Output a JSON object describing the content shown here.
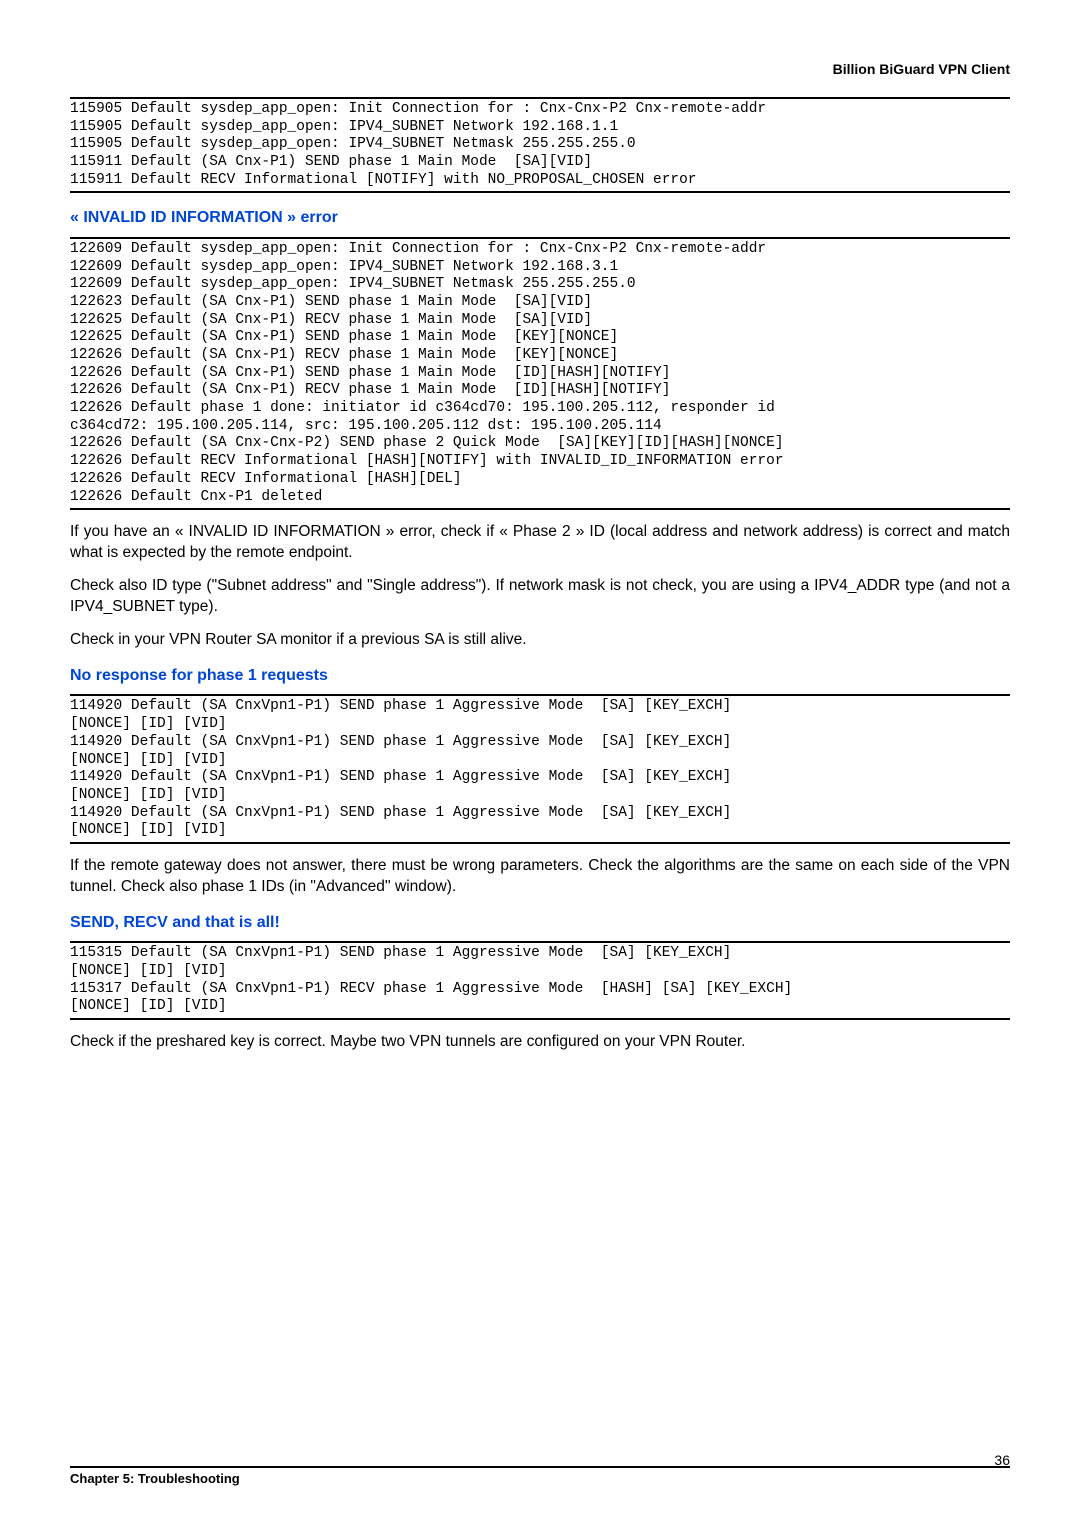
{
  "header": {
    "title": "Billion BiGuard VPN Client"
  },
  "logs": {
    "log1": "115905 Default sysdep_app_open: Init Connection for : Cnx-Cnx-P2 Cnx-remote-addr\n115905 Default sysdep_app_open: IPV4_SUBNET Network 192.168.1.1\n115905 Default sysdep_app_open: IPV4_SUBNET Netmask 255.255.255.0\n115911 Default (SA Cnx-P1) SEND phase 1 Main Mode  [SA][VID]\n115911 Default RECV Informational [NOTIFY] with NO_PROPOSAL_CHOSEN error",
    "log2": "122609 Default sysdep_app_open: Init Connection for : Cnx-Cnx-P2 Cnx-remote-addr\n122609 Default sysdep_app_open: IPV4_SUBNET Network 192.168.3.1\n122609 Default sysdep_app_open: IPV4_SUBNET Netmask 255.255.255.0\n122623 Default (SA Cnx-P1) SEND phase 1 Main Mode  [SA][VID]\n122625 Default (SA Cnx-P1) RECV phase 1 Main Mode  [SA][VID]\n122625 Default (SA Cnx-P1) SEND phase 1 Main Mode  [KEY][NONCE]\n122626 Default (SA Cnx-P1) RECV phase 1 Main Mode  [KEY][NONCE]\n122626 Default (SA Cnx-P1) SEND phase 1 Main Mode  [ID][HASH][NOTIFY]\n122626 Default (SA Cnx-P1) RECV phase 1 Main Mode  [ID][HASH][NOTIFY]\n122626 Default phase 1 done: initiator id c364cd70: 195.100.205.112, responder id\nc364cd72: 195.100.205.114, src: 195.100.205.112 dst: 195.100.205.114\n122626 Default (SA Cnx-Cnx-P2) SEND phase 2 Quick Mode  [SA][KEY][ID][HASH][NONCE]\n122626 Default RECV Informational [HASH][NOTIFY] with INVALID_ID_INFORMATION error\n122626 Default RECV Informational [HASH][DEL]\n122626 Default Cnx-P1 deleted",
    "log3": "114920 Default (SA CnxVpn1-P1) SEND phase 1 Aggressive Mode  [SA] [KEY_EXCH]\n[NONCE] [ID] [VID]\n114920 Default (SA CnxVpn1-P1) SEND phase 1 Aggressive Mode  [SA] [KEY_EXCH]\n[NONCE] [ID] [VID]\n114920 Default (SA CnxVpn1-P1) SEND phase 1 Aggressive Mode  [SA] [KEY_EXCH]\n[NONCE] [ID] [VID]\n114920 Default (SA CnxVpn1-P1) SEND phase 1 Aggressive Mode  [SA] [KEY_EXCH]\n[NONCE] [ID] [VID]",
    "log4": "115315 Default (SA CnxVpn1-P1) SEND phase 1 Aggressive Mode  [SA] [KEY_EXCH]\n[NONCE] [ID] [VID]\n115317 Default (SA CnxVpn1-P1) RECV phase 1 Aggressive Mode  [HASH] [SA] [KEY_EXCH]\n[NONCE] [ID] [VID]"
  },
  "headings": {
    "h1": "« INVALID ID INFORMATION » error",
    "h2": "No response for phase 1 requests",
    "h3": "SEND, RECV and that is all!"
  },
  "paragraphs": {
    "p1": "If you have an « INVALID ID INFORMATION » error, check if « Phase 2 » ID (local address and network address) is correct and match what is expected by the remote endpoint.",
    "p2": "Check also ID type (\"Subnet address\" and \"Single address\"). If network mask is not check, you are using a IPV4_ADDR type (and not a IPV4_SUBNET type).",
    "p3": "Check in your VPN Router SA monitor if a previous SA is still alive.",
    "p4": "If the remote gateway does not answer, there must be wrong parameters. Check the algorithms are the same on each side of the VPN tunnel. Check also phase 1 IDs (in \"Advanced'' window).",
    "p5": "Check if the preshared key is correct. Maybe two VPN tunnels are configured on your VPN Router."
  },
  "footer": {
    "chapter": "Chapter 5: Troubleshooting",
    "page": "36"
  }
}
